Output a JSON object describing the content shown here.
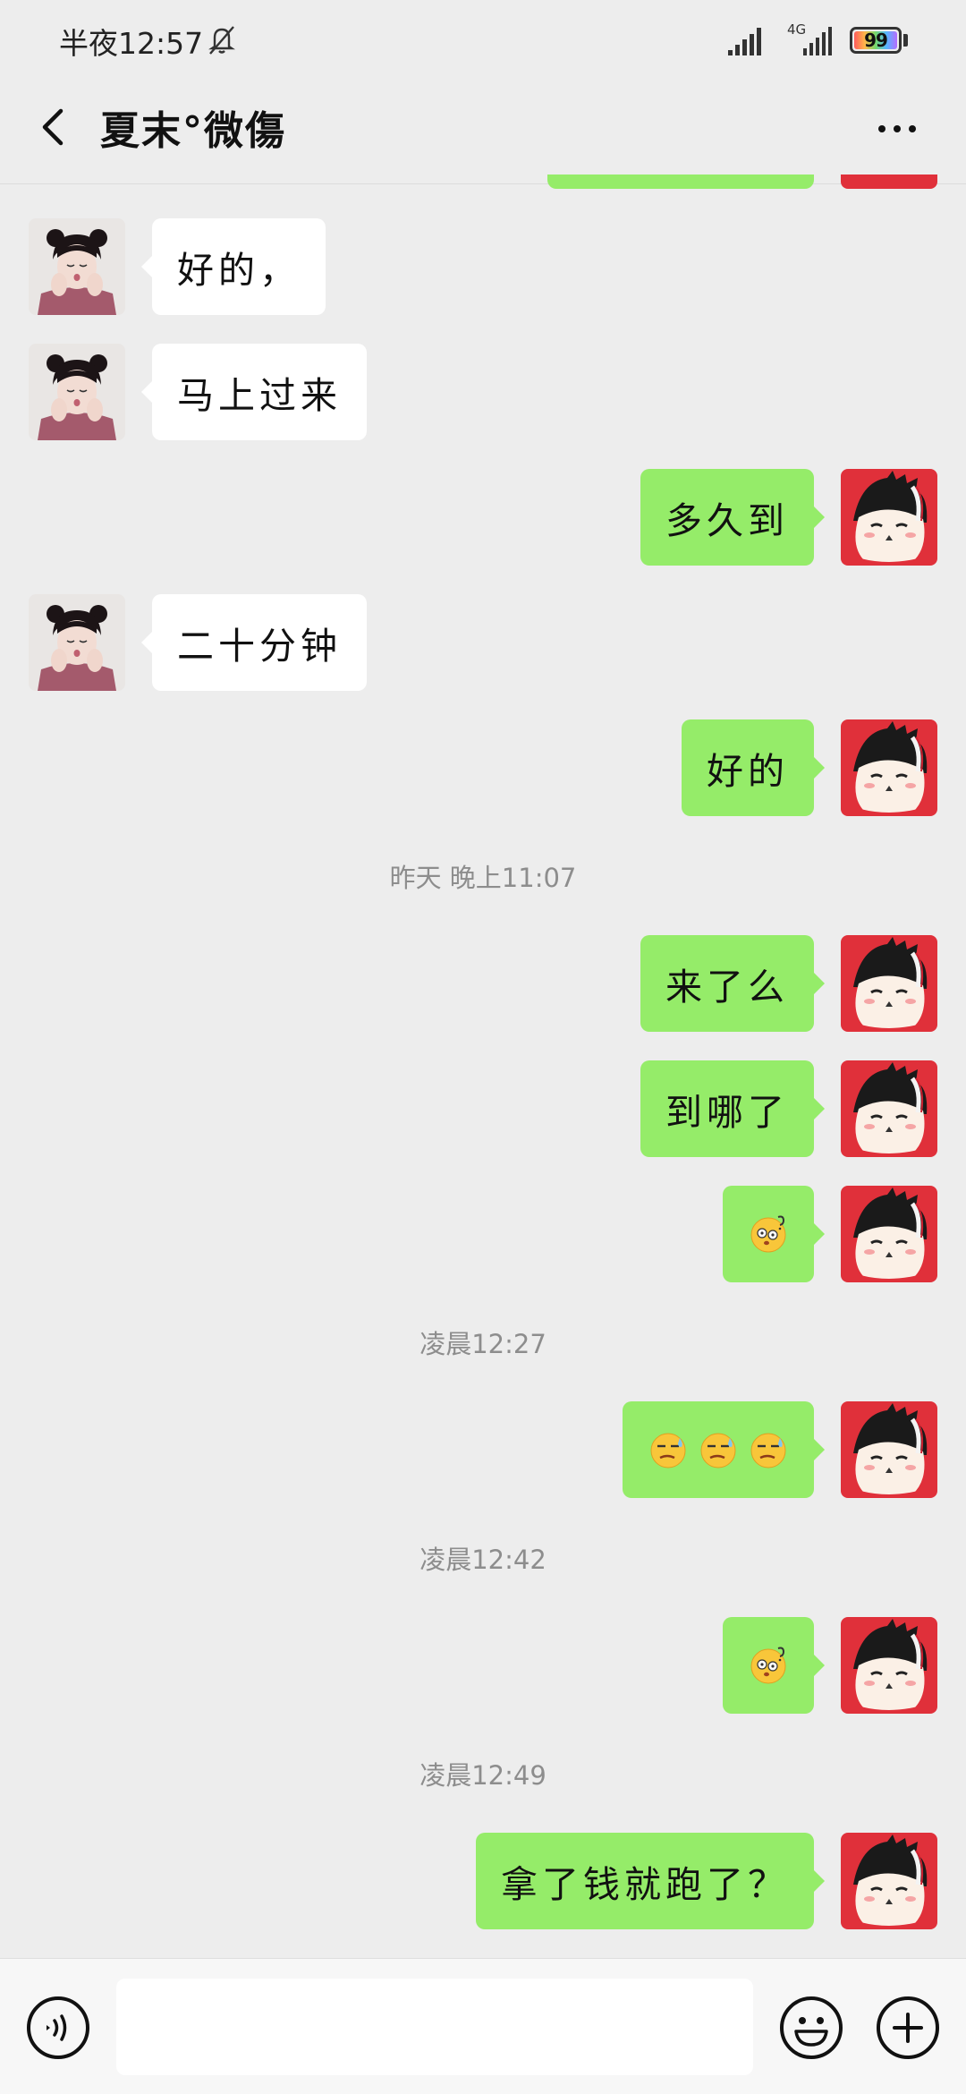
{
  "status_bar": {
    "time": "半夜12:57",
    "network": "4G",
    "battery": "99"
  },
  "header": {
    "title": "夏末°微傷"
  },
  "messages": [
    {
      "side": "left",
      "text": "好的，"
    },
    {
      "side": "left",
      "text": "马上过来"
    },
    {
      "side": "right",
      "text": "多久到"
    },
    {
      "side": "left",
      "text": "二十分钟"
    },
    {
      "side": "right",
      "text": "好的"
    },
    {
      "type": "time",
      "text": "昨天 晚上11:07"
    },
    {
      "side": "right",
      "text": "来了么"
    },
    {
      "side": "right",
      "text": "到哪了"
    },
    {
      "side": "right",
      "emoji": [
        "dizzy-face"
      ]
    },
    {
      "type": "time",
      "text": "凌晨12:27"
    },
    {
      "side": "right",
      "emoji": [
        "sweat-smirk",
        "sweat-smirk",
        "sweat-smirk"
      ]
    },
    {
      "type": "time",
      "text": "凌晨12:42"
    },
    {
      "side": "right",
      "emoji": [
        "dizzy-face"
      ]
    },
    {
      "type": "time",
      "text": "凌晨12:49"
    },
    {
      "side": "right",
      "text": "拿了钱就跑了？"
    }
  ],
  "input": {
    "value": ""
  },
  "colors": {
    "background": "#ededed",
    "self_bubble": "#95ec69",
    "other_bubble": "#ffffff",
    "self_avatar_bg": "#e0303a"
  },
  "icons": [
    "back-arrow-icon",
    "more-dots-icon",
    "voice-icon",
    "emoji-icon",
    "plus-icon",
    "mute-bell-icon",
    "signal-icon"
  ]
}
